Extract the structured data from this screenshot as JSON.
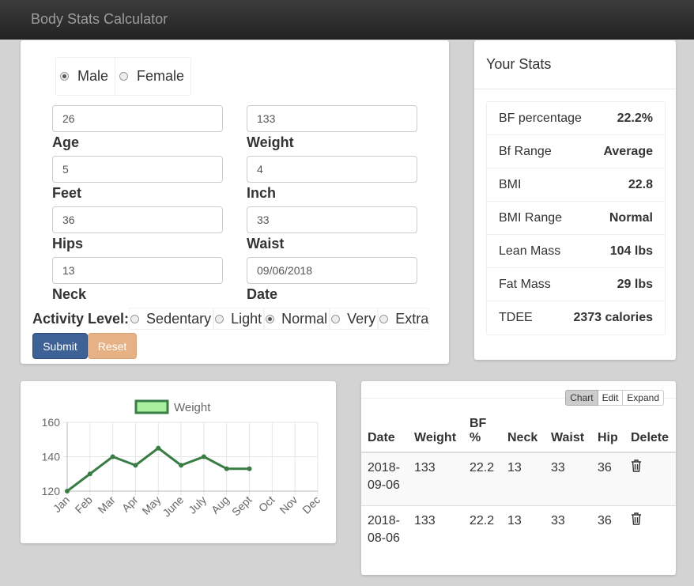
{
  "app": {
    "title": "Body Stats Calculator"
  },
  "form": {
    "gender": {
      "options": [
        {
          "label": "Male",
          "checked": true
        },
        {
          "label": "Female",
          "checked": false
        }
      ]
    },
    "fields": {
      "age": {
        "label": "Age",
        "value": "26"
      },
      "weight": {
        "label": "Weight",
        "value": "133"
      },
      "feet": {
        "label": "Feet",
        "value": "5"
      },
      "inch": {
        "label": "Inch",
        "value": "4"
      },
      "hips": {
        "label": "Hips",
        "value": "36"
      },
      "waist": {
        "label": "Waist",
        "value": "33"
      },
      "neck": {
        "label": "Neck",
        "value": "13"
      },
      "date": {
        "label": "Date",
        "value": "09/06/2018"
      }
    },
    "activity": {
      "label": "Activity Level:",
      "options": [
        {
          "label": "Sedentary",
          "checked": false
        },
        {
          "label": "Light",
          "checked": false
        },
        {
          "label": "Normal",
          "checked": true
        },
        {
          "label": "Very",
          "checked": false
        },
        {
          "label": "Extra",
          "checked": false
        }
      ]
    },
    "submit_label": "Submit",
    "reset_label": "Reset"
  },
  "stats": {
    "title": "Your Stats",
    "rows": [
      {
        "label": "BF percentage",
        "value": "22.2%"
      },
      {
        "label": "Bf Range",
        "value": "Average"
      },
      {
        "label": "BMI",
        "value": "22.8"
      },
      {
        "label": "BMI Range",
        "value": "Normal"
      },
      {
        "label": "Lean Mass",
        "value": "104 lbs"
      },
      {
        "label": "Fat Mass",
        "value": "29 lbs"
      },
      {
        "label": "TDEE",
        "value": "2373 calories"
      }
    ]
  },
  "chart_data": {
    "type": "line",
    "categories": [
      "Jan",
      "Feb",
      "Mar",
      "Apr",
      "May",
      "June",
      "July",
      "Aug",
      "Sept",
      "Oct",
      "Nov",
      "Dec"
    ],
    "series": [
      {
        "name": "Weight",
        "values": [
          120,
          130,
          140,
          135,
          145,
          135,
          140,
          133,
          133,
          null,
          null,
          null
        ]
      }
    ],
    "yticks": [
      120,
      140,
      160
    ],
    "ylim": [
      120,
      160
    ],
    "grid": true,
    "legend": "top",
    "colors": {
      "line": "#3a7d44",
      "legend_fill": "#a8f0a0"
    }
  },
  "history": {
    "toolbar": [
      "Chart",
      "Edit",
      "Expand"
    ],
    "columns": [
      "Date",
      "Weight",
      "BF %",
      "Neck",
      "Waist",
      "Hip",
      "Delete"
    ],
    "rows": [
      {
        "date": "2018-09-06",
        "weight": "133",
        "bf": "22.2",
        "neck": "13",
        "waist": "33",
        "hip": "36"
      },
      {
        "date": "2018-08-06",
        "weight": "133",
        "bf": "22.2",
        "neck": "13",
        "waist": "33",
        "hip": "36"
      }
    ]
  }
}
